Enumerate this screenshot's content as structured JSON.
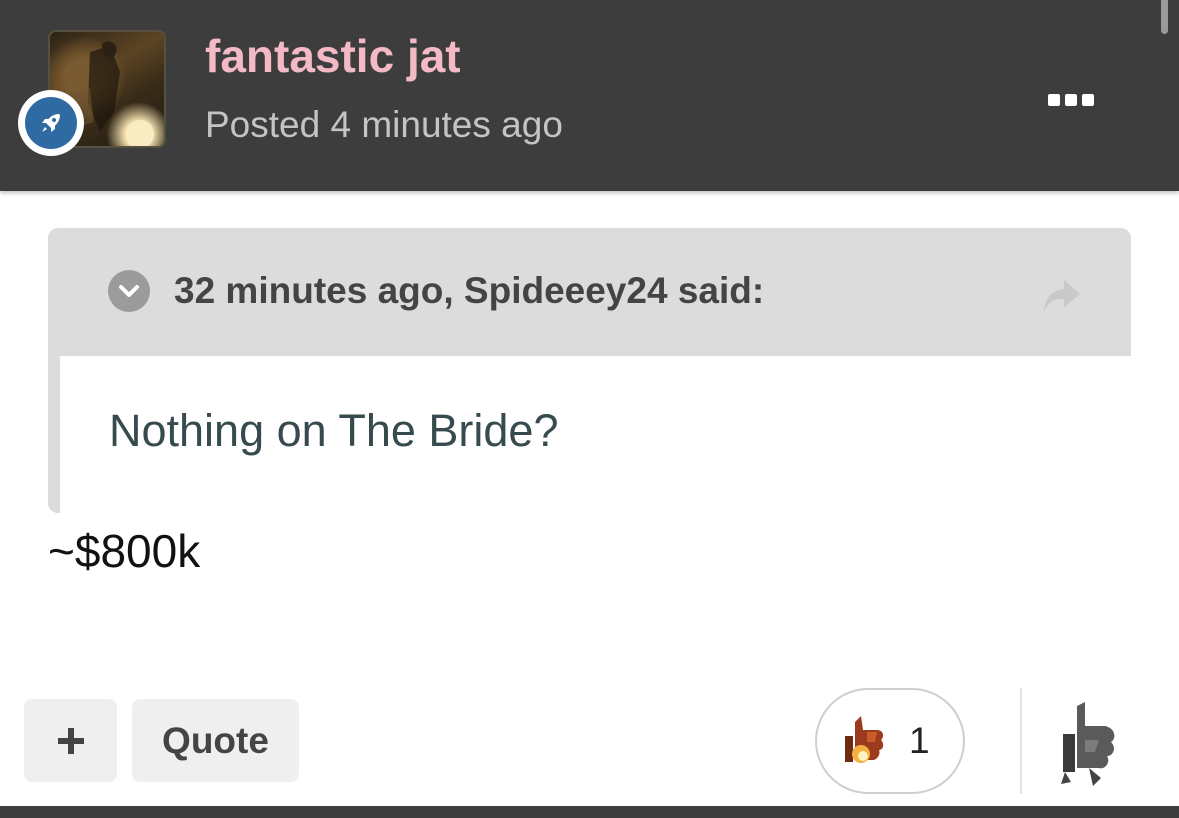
{
  "author": {
    "username": "fantastic jat",
    "posted_time": "Posted 4 minutes ago",
    "avatar_icon": "user-avatar",
    "badge_icon": "rocket-icon",
    "username_color": "#f3b9c5"
  },
  "menu": {
    "more_icon": "ellipsis-icon"
  },
  "quote": {
    "citation": "32 minutes ago, Spideeey24 said:",
    "body": "Nothing on The Bride?",
    "toggle_icon": "chevron-down-icon",
    "share_icon": "share-arrow-icon"
  },
  "post": {
    "text": "~$800k"
  },
  "actions": {
    "plus_label": "+",
    "quote_label": "Quote",
    "reaction_count": "1",
    "reaction_icon": "thumbs-up-icon",
    "react_button_icon": "thumbs-up-icon"
  }
}
